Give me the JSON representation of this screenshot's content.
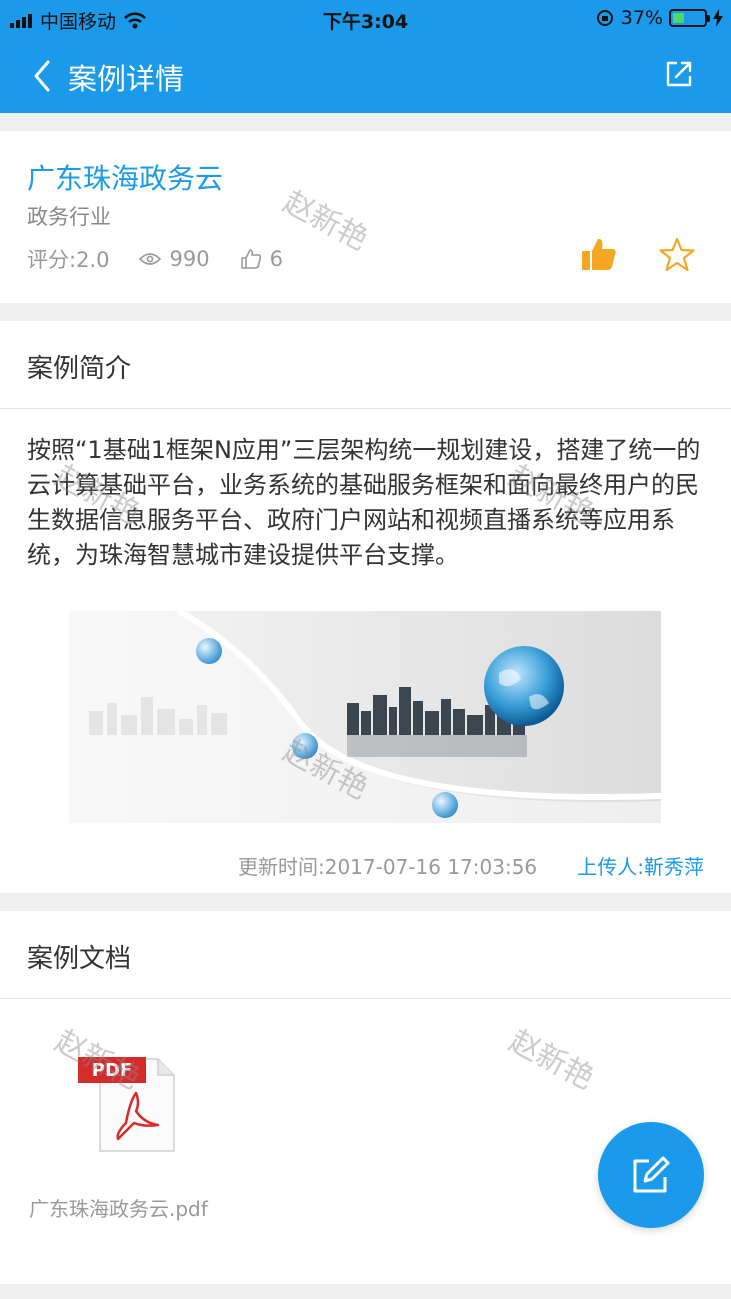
{
  "status_bar": {
    "carrier": "中国移动",
    "time": "下午3:04",
    "battery": "37%"
  },
  "nav": {
    "title": "案例详情",
    "back_icon": "chevron-left-icon",
    "share_icon": "share-icon"
  },
  "case": {
    "title": "广东珠海政务云",
    "industry": "政务行业",
    "rating": "评分:2.0",
    "views": "990",
    "likes": "6"
  },
  "intro_section": {
    "heading": "案例简介",
    "text": "按照“1基础1框架N应用”三层架构统一规划建设，搭建了统一的云计算基础平台，业务系统的基础服务框架和面向最终用户的民生数据信息服务平台、政府门户网站和视频直播系统等应用系统，为珠海智慧城市建设提供平台支撑。",
    "update_time": "更新时间:2017-07-16 17:03:56",
    "uploader": "上传人:靳秀萍"
  },
  "docs_section": {
    "heading": "案例文档",
    "file_name": "广东珠海政务云.pdf",
    "file_badge": "PDF"
  },
  "watermark": "赵新艳",
  "colors": {
    "primary": "#1b9aeb",
    "like": "#f5a623"
  }
}
